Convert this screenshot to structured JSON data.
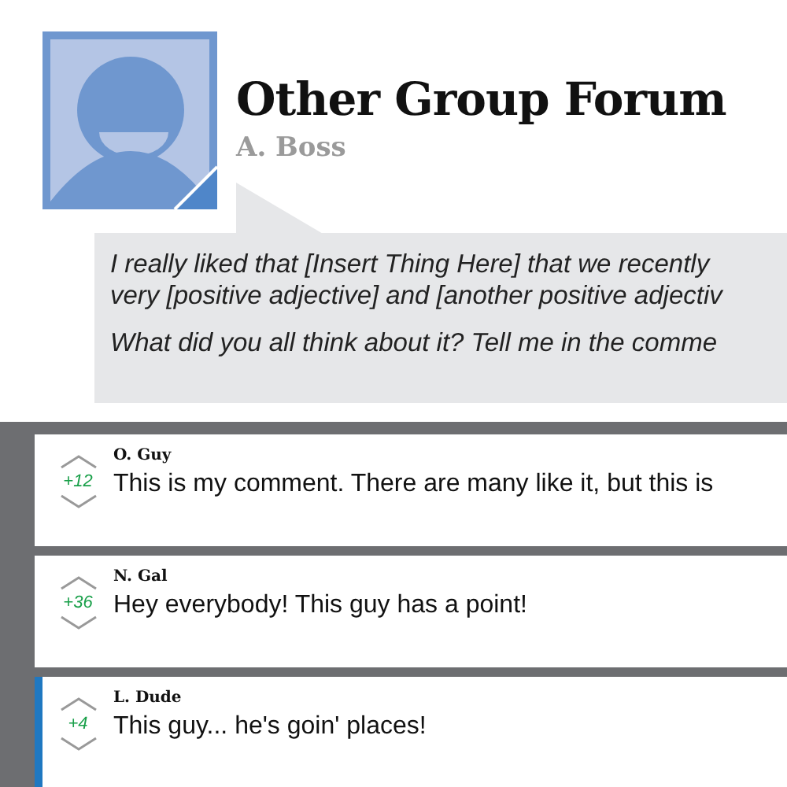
{
  "post": {
    "title": "Other Group Forum",
    "author": "A. Boss",
    "paragraphs": [
      [
        "I really liked that [Insert Thing Here] that we recently",
        "very [positive adjective] and [another positive adjectiv"
      ],
      [
        "What did you all think about it? Tell me in the comme"
      ]
    ]
  },
  "comments": [
    {
      "author": "O. Guy",
      "score": "+12",
      "text": "This is my comment. There are many like it, but this is",
      "selected": false
    },
    {
      "author": "N. Gal",
      "score": "+36",
      "text": "Hey everybody! This guy has a point!",
      "selected": false
    },
    {
      "author": "L. Dude",
      "score": "+4",
      "text": "This guy... he's goin' places!",
      "selected": true
    }
  ]
}
